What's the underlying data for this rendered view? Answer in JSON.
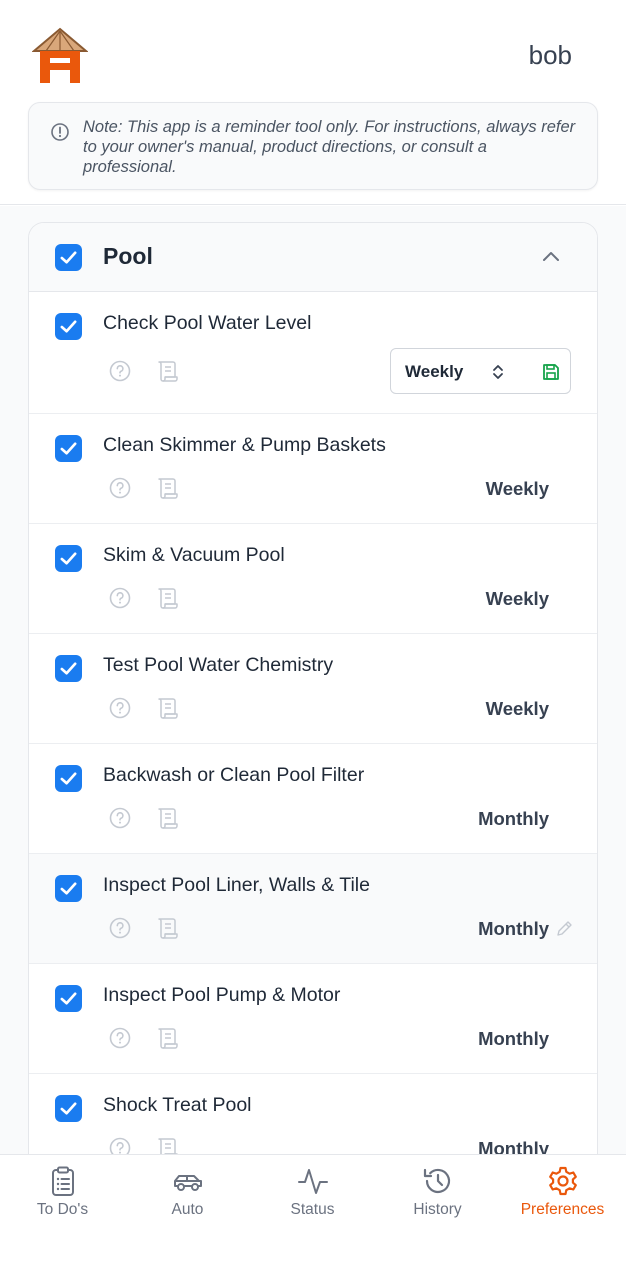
{
  "header": {
    "user_name": "bob",
    "note": "Note: This app is a reminder tool only. For instructions, always refer to your owner's manual, product directions, or consult a professional."
  },
  "section": {
    "title": "Pool",
    "checked": true,
    "tasks": [
      {
        "title": "Check Pool Water Level",
        "frequency": "Weekly",
        "editing": true
      },
      {
        "title": "Clean Skimmer & Pump Baskets",
        "frequency": "Weekly"
      },
      {
        "title": "Skim & Vacuum Pool",
        "frequency": "Weekly"
      },
      {
        "title": "Test Pool Water Chemistry",
        "frequency": "Weekly"
      },
      {
        "title": "Backwash or Clean Pool Filter",
        "frequency": "Monthly"
      },
      {
        "title": "Inspect Pool Liner, Walls & Tile",
        "frequency": "Monthly",
        "hovered": true
      },
      {
        "title": "Inspect Pool Pump & Motor",
        "frequency": "Monthly"
      },
      {
        "title": "Shock Treat Pool",
        "frequency": "Monthly"
      }
    ]
  },
  "nav": {
    "items": [
      {
        "label": "To Do's",
        "icon": "clipboard-icon"
      },
      {
        "label": "Auto",
        "icon": "car-icon"
      },
      {
        "label": "Status",
        "icon": "activity-icon"
      },
      {
        "label": "History",
        "icon": "history-icon"
      },
      {
        "label": "Preferences",
        "icon": "gear-icon",
        "active": true
      }
    ]
  },
  "colors": {
    "accent": "#ea580c",
    "checkbox": "#1a7cf0",
    "save": "#16a34a"
  }
}
